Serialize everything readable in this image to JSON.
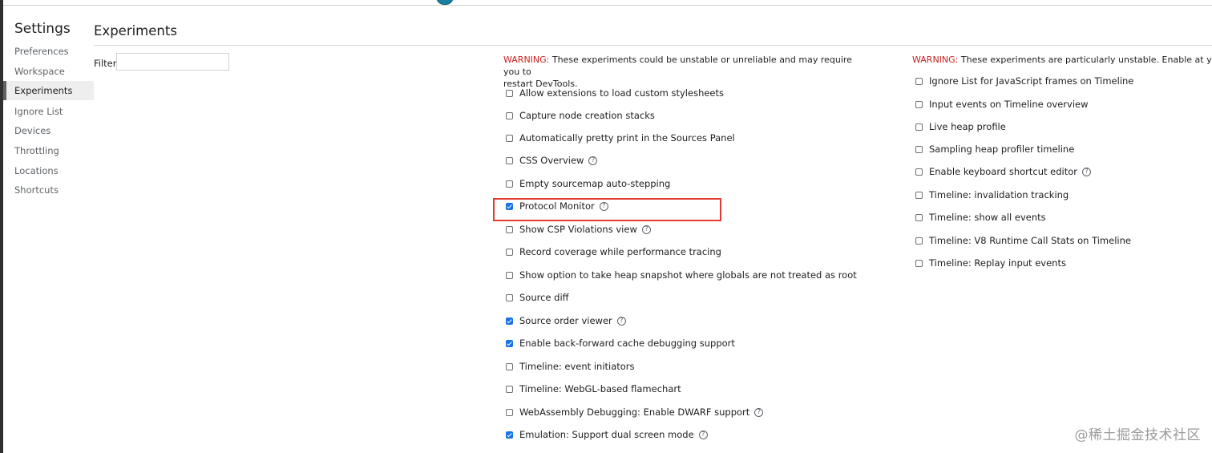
{
  "sidebar": {
    "title": "Settings",
    "items": [
      {
        "label": "Preferences",
        "selected": false
      },
      {
        "label": "Workspace",
        "selected": false
      },
      {
        "label": "Experiments",
        "selected": true
      },
      {
        "label": "Ignore List",
        "selected": false
      },
      {
        "label": "Devices",
        "selected": false
      },
      {
        "label": "Throttling",
        "selected": false
      },
      {
        "label": "Locations",
        "selected": false
      },
      {
        "label": "Shortcuts",
        "selected": false
      }
    ]
  },
  "main": {
    "title": "Experiments",
    "filter": {
      "label": "Filter",
      "value": "",
      "placeholder": ""
    }
  },
  "column_left": {
    "warning_prefix": "WARNING:",
    "warning_line1": " These experiments could be unstable or unreliable and may require you to",
    "warning_line2": "restart DevTools.",
    "items": [
      {
        "label": "Allow extensions to load custom stylesheets",
        "checked": false,
        "help": false
      },
      {
        "label": "Capture node creation stacks",
        "checked": false,
        "help": false
      },
      {
        "label": "Automatically pretty print in the Sources Panel",
        "checked": false,
        "help": false
      },
      {
        "label": "CSS Overview",
        "checked": false,
        "help": true
      },
      {
        "label": "Empty sourcemap auto-stepping",
        "checked": false,
        "help": false
      },
      {
        "label": "Protocol Monitor",
        "checked": true,
        "help": true
      },
      {
        "label": "Show CSP Violations view",
        "checked": false,
        "help": true
      },
      {
        "label": "Record coverage while performance tracing",
        "checked": false,
        "help": false
      },
      {
        "label": "Show option to take heap snapshot where globals are not treated as root",
        "checked": false,
        "help": false
      },
      {
        "label": "Source diff",
        "checked": false,
        "help": false
      },
      {
        "label": "Source order viewer",
        "checked": true,
        "help": true
      },
      {
        "label": "Enable back-forward cache debugging support",
        "checked": true,
        "help": false
      },
      {
        "label": "Timeline: event initiators",
        "checked": false,
        "help": false
      },
      {
        "label": "Timeline: WebGL-based flamechart",
        "checked": false,
        "help": false
      },
      {
        "label": "WebAssembly Debugging: Enable DWARF support",
        "checked": false,
        "help": true
      },
      {
        "label": "Emulation: Support dual screen mode",
        "checked": true,
        "help": true
      }
    ]
  },
  "column_right": {
    "warning_prefix": "WARNING:",
    "warning_line1": " These experiments are particularly unstable. Enable at your own",
    "items": [
      {
        "label": "Ignore List for JavaScript frames on Timeline",
        "checked": false,
        "help": false
      },
      {
        "label": "Input events on Timeline overview",
        "checked": false,
        "help": false
      },
      {
        "label": "Live heap profile",
        "checked": false,
        "help": false
      },
      {
        "label": "Sampling heap profiler timeline",
        "checked": false,
        "help": false
      },
      {
        "label": "Enable keyboard shortcut editor",
        "checked": false,
        "help": true
      },
      {
        "label": "Timeline: invalidation tracking",
        "checked": false,
        "help": false
      },
      {
        "label": "Timeline: show all events",
        "checked": false,
        "help": false
      },
      {
        "label": "Timeline: V8 Runtime Call Stats on Timeline",
        "checked": false,
        "help": false
      },
      {
        "label": "Timeline: Replay input events",
        "checked": false,
        "help": false
      }
    ]
  },
  "help_glyph": "?",
  "watermark": "@稀土掘金技术社区",
  "colors": {
    "accent": "#1a73e8",
    "warning": "#c5221f",
    "highlight": "#e53935"
  }
}
